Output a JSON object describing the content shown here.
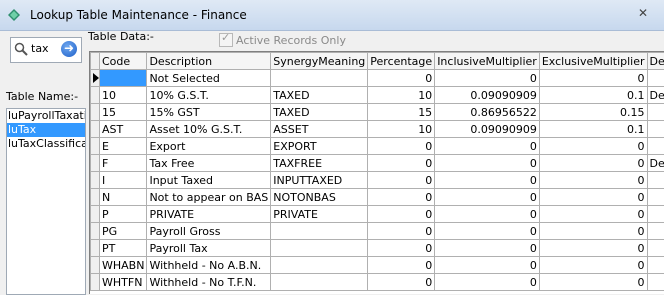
{
  "window": {
    "title": "Lookup Table Maintenance - Finance",
    "close_symbol": "✕"
  },
  "search": {
    "value": "tax",
    "go_symbol": "➜"
  },
  "table_name_label": "Table Name:-",
  "table_names": [
    "luPayrollTaxati",
    "luTax",
    "luTaxClassifica"
  ],
  "selected_table": "luTax",
  "table_data_label": "Table Data:-",
  "active_records_label": "Active Records Only",
  "active_records_check": "✓",
  "columns": [
    "Code",
    "Description",
    "SynergyMeaning",
    "Percentage",
    "InclusiveMultiplier",
    "ExclusiveMultiplier",
    "DefaultType"
  ],
  "rows": [
    [
      "",
      "Not Selected",
      "",
      "0",
      "0",
      "0",
      ""
    ],
    [
      "10",
      "10% G.S.T.",
      "TAXED",
      "10",
      "0.09090909",
      "0.1",
      "DefaultTaxed"
    ],
    [
      "15",
      "15% GST",
      "TAXED",
      "15",
      "0.86956522",
      "0.15",
      ""
    ],
    [
      "AST",
      "Asset 10% G.S.T.",
      "ASSET",
      "10",
      "0.09090909",
      "0.1",
      ""
    ],
    [
      "E",
      "Export",
      "EXPORT",
      "0",
      "0",
      "0",
      ""
    ],
    [
      "F",
      "Tax Free",
      "TAXFREE",
      "0",
      "0",
      "0",
      "DefaultTaxFree"
    ],
    [
      "I",
      "Input Taxed",
      "INPUTTAXED",
      "0",
      "0",
      "0",
      ""
    ],
    [
      "N",
      "Not to appear on BAS",
      "NOTONBAS",
      "0",
      "0",
      "0",
      ""
    ],
    [
      "P",
      "PRIVATE",
      "PRIVATE",
      "0",
      "0",
      "0",
      ""
    ],
    [
      "PG",
      "Payroll Gross",
      "",
      "0",
      "0",
      "0",
      ""
    ],
    [
      "PT",
      "Payroll Tax",
      "",
      "0",
      "0",
      "0",
      ""
    ],
    [
      "WHABN",
      "Withheld - No A.B.N.",
      "",
      "0",
      "0",
      "0",
      ""
    ],
    [
      "WHTFN",
      "Withheld - No T.F.N.",
      "",
      "0",
      "0",
      "0",
      ""
    ]
  ],
  "colors": {
    "selection": "#3399ff",
    "title_gradient_top": "#dfe9f5"
  }
}
